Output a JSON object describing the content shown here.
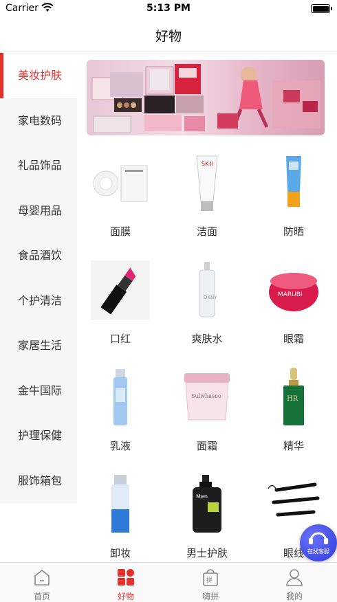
{
  "status_bar": {
    "carrier": "Carrier",
    "time": "5:13 PM"
  },
  "nav": {
    "title": "好物"
  },
  "sidebar": {
    "items": [
      {
        "label": "美妆护肤",
        "active": true
      },
      {
        "label": "家电数码"
      },
      {
        "label": "礼品饰品"
      },
      {
        "label": "母婴用品"
      },
      {
        "label": "食品酒饮"
      },
      {
        "label": "个护清洁"
      },
      {
        "label": "家居生活"
      },
      {
        "label": "金牛国际"
      },
      {
        "label": "护理保健"
      },
      {
        "label": "服饰箱包"
      }
    ]
  },
  "products": [
    {
      "label": "面膜",
      "icon": "mask-product-icon"
    },
    {
      "label": "洁面",
      "icon": "cleanser-product-icon"
    },
    {
      "label": "防晒",
      "icon": "sunscreen-product-icon"
    },
    {
      "label": "口红",
      "icon": "lipstick-product-icon"
    },
    {
      "label": "爽肤水",
      "icon": "toner-product-icon"
    },
    {
      "label": "眼霜",
      "icon": "eye-cream-product-icon"
    },
    {
      "label": "乳液",
      "icon": "lotion-product-icon"
    },
    {
      "label": "面霜",
      "icon": "face-cream-product-icon"
    },
    {
      "label": "精华",
      "icon": "serum-product-icon"
    },
    {
      "label": "卸妆",
      "icon": "makeup-remover-product-icon"
    },
    {
      "label": "男士护肤",
      "icon": "mens-skincare-product-icon"
    },
    {
      "label": "眼线",
      "icon": "eyeliner-product-icon"
    }
  ],
  "customer_service": {
    "label": "在线客服"
  },
  "tab_bar": {
    "tabs": [
      {
        "label": "首页",
        "icon": "home-icon"
      },
      {
        "label": "好物",
        "icon": "grid-icon",
        "active": true
      },
      {
        "label": "嗨拼",
        "icon": "shopping-bag-icon"
      },
      {
        "label": "我的",
        "icon": "user-icon"
      }
    ]
  },
  "colors": {
    "accent": "#e5322f",
    "sidebar_bg": "#f7f7f7",
    "cs_button": "#3b46e0"
  }
}
